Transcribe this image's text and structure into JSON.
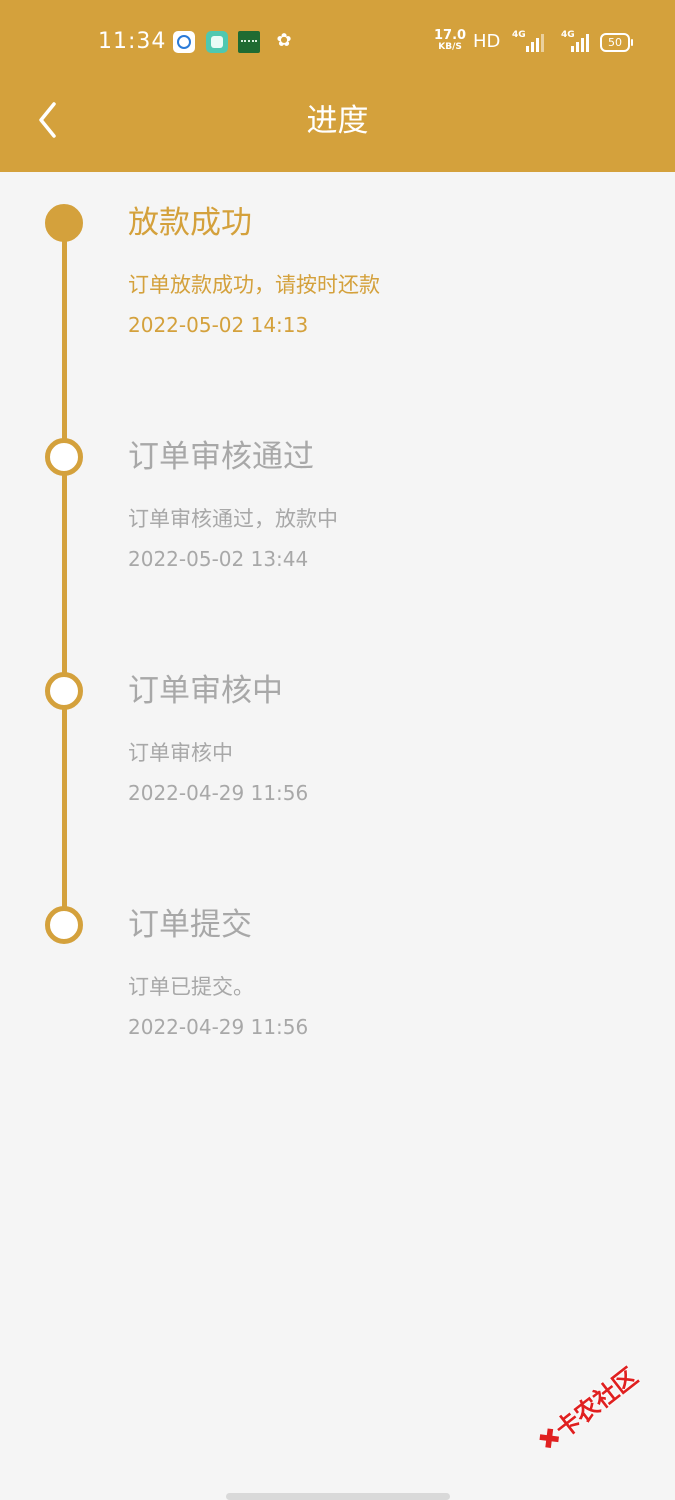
{
  "status_bar": {
    "time": "11:34",
    "net_speed": "17.0",
    "net_speed_unit": "KB/S",
    "hd_label": "HD",
    "signal_1": "4G",
    "signal_2": "4G",
    "battery": "50",
    "icons": [
      "qq-browser-icon",
      "chat-app-icon",
      "bank-app-icon",
      "squirrel-app-icon"
    ]
  },
  "header": {
    "back_icon": "chevron-left-icon",
    "title": "进度"
  },
  "colors": {
    "accent": "#d4a13c",
    "inactive_text": "#a8a8a8",
    "background": "#f5f5f5"
  },
  "timeline": [
    {
      "title": "放款成功",
      "desc": "订单放款成功，请按时还款",
      "time": "2022-05-02 14:13",
      "active": true
    },
    {
      "title": "订单审核通过",
      "desc": "订单审核通过，放款中",
      "time": "2022-05-02 13:44",
      "active": false
    },
    {
      "title": "订单审核中",
      "desc": "订单审核中",
      "time": "2022-04-29 11:56",
      "active": false
    },
    {
      "title": "订单提交",
      "desc": "订单已提交。",
      "time": "2022-04-29 11:56",
      "active": false
    }
  ],
  "watermark": {
    "text": "卡农社区"
  }
}
